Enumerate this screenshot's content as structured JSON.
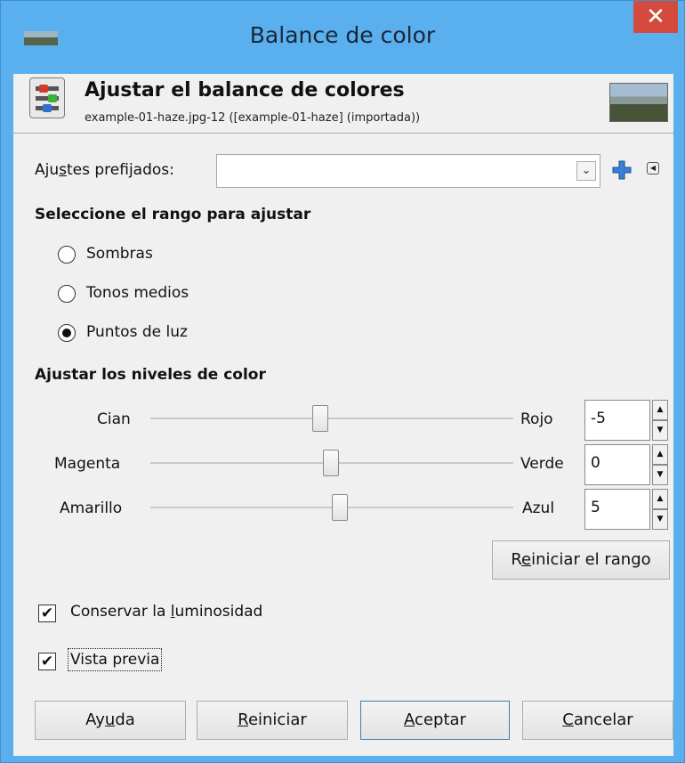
{
  "window": {
    "title": "Balance de color",
    "close_glyph": "✕"
  },
  "header": {
    "title": "Ajustar el balance de colores",
    "subtitle": "example-01-haze.jpg-12 ([example-01-haze] (importada))"
  },
  "presets": {
    "label_pre": "Aju",
    "label_mnemonic": "s",
    "label_post": "tes prefijados:",
    "value": "",
    "arrow_glyph": "⌄",
    "add_glyph": "+",
    "menu_glyph": "◀"
  },
  "range": {
    "heading": "Seleccione el rango para ajustar",
    "options": [
      "Sombras",
      "Tonos medios",
      "Puntos de luz"
    ],
    "selected": "Puntos de luz"
  },
  "levels": {
    "heading": "Ajustar los niveles de color",
    "sliders": [
      {
        "left": "Cian",
        "right": "Rojo",
        "value": "-5"
      },
      {
        "left": "Magenta",
        "right": "Verde",
        "value": "0"
      },
      {
        "left": "Amarillo",
        "right": "Azul",
        "value": "5"
      }
    ],
    "spin_up_glyph": "▲",
    "spin_down_glyph": "▼",
    "reset_range_pre": "R",
    "reset_range_mnemonic": "e",
    "reset_range_post": "iniciar el rango"
  },
  "options": {
    "preserve_pre": "Conservar la ",
    "preserve_mnemonic": "l",
    "preserve_post": "uminosidad",
    "preview_label": "Vista previa",
    "check_glyph": "✔"
  },
  "buttons": {
    "help_pre": "Ay",
    "help_mnemonic": "u",
    "help_post": "da",
    "reset_mnemonic": "R",
    "reset_post": "einiciar",
    "ok_mnemonic": "A",
    "ok_post": "ceptar",
    "cancel_mnemonic": "C",
    "cancel_post": "ancelar"
  },
  "colors": {
    "titlebar": "#5ab0ee",
    "close_button": "#d44a3c",
    "dialog_bg": "#f0f0f0"
  }
}
